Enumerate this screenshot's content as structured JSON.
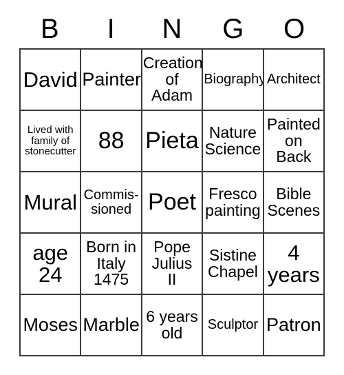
{
  "card": {
    "header_letters": [
      "B",
      "I",
      "N",
      "G",
      "O"
    ],
    "rows": [
      [
        {
          "text": "David",
          "size": "fs-xl"
        },
        {
          "text": "Painter",
          "size": "fs-lg"
        },
        {
          "text": "Creation\nof\nAdam",
          "size": "fs-md"
        },
        {
          "text": "Biography",
          "size": "fs-sm"
        },
        {
          "text": "Architect",
          "size": "fs-sm"
        }
      ],
      [
        {
          "text": "Lived with\nfamily of\nstonecutter",
          "size": "fs-xs"
        },
        {
          "text": "88",
          "size": "fs-xxl"
        },
        {
          "text": "Pieta",
          "size": "fs-xxl"
        },
        {
          "text": "Nature\nScience",
          "size": "fs-md"
        },
        {
          "text": "Painted\non\nBack",
          "size": "fs-md"
        }
      ],
      [
        {
          "text": "Mural",
          "size": "fs-xl"
        },
        {
          "text": "Commis-\nsioned",
          "size": "fs-sm"
        },
        {
          "text": "Poet",
          "size": "fs-xxl"
        },
        {
          "text": "Fresco\npainting",
          "size": "fs-md"
        },
        {
          "text": "Bible\nScenes",
          "size": "fs-md"
        }
      ],
      [
        {
          "text": "age\n24",
          "size": "fs-xl"
        },
        {
          "text": "Born in\nItaly\n1475",
          "size": "fs-md"
        },
        {
          "text": "Pope\nJulius\nII",
          "size": "fs-md"
        },
        {
          "text": "Sistine\nChapel",
          "size": "fs-md"
        },
        {
          "text": "4\nyears",
          "size": "fs-xl"
        }
      ],
      [
        {
          "text": "Moses",
          "size": "fs-lg"
        },
        {
          "text": "Marble",
          "size": "fs-lg"
        },
        {
          "text": "6 years\nold",
          "size": "fs-md"
        },
        {
          "text": "Sculptor",
          "size": "fs-sm"
        },
        {
          "text": "Patron",
          "size": "fs-lg"
        }
      ]
    ]
  }
}
